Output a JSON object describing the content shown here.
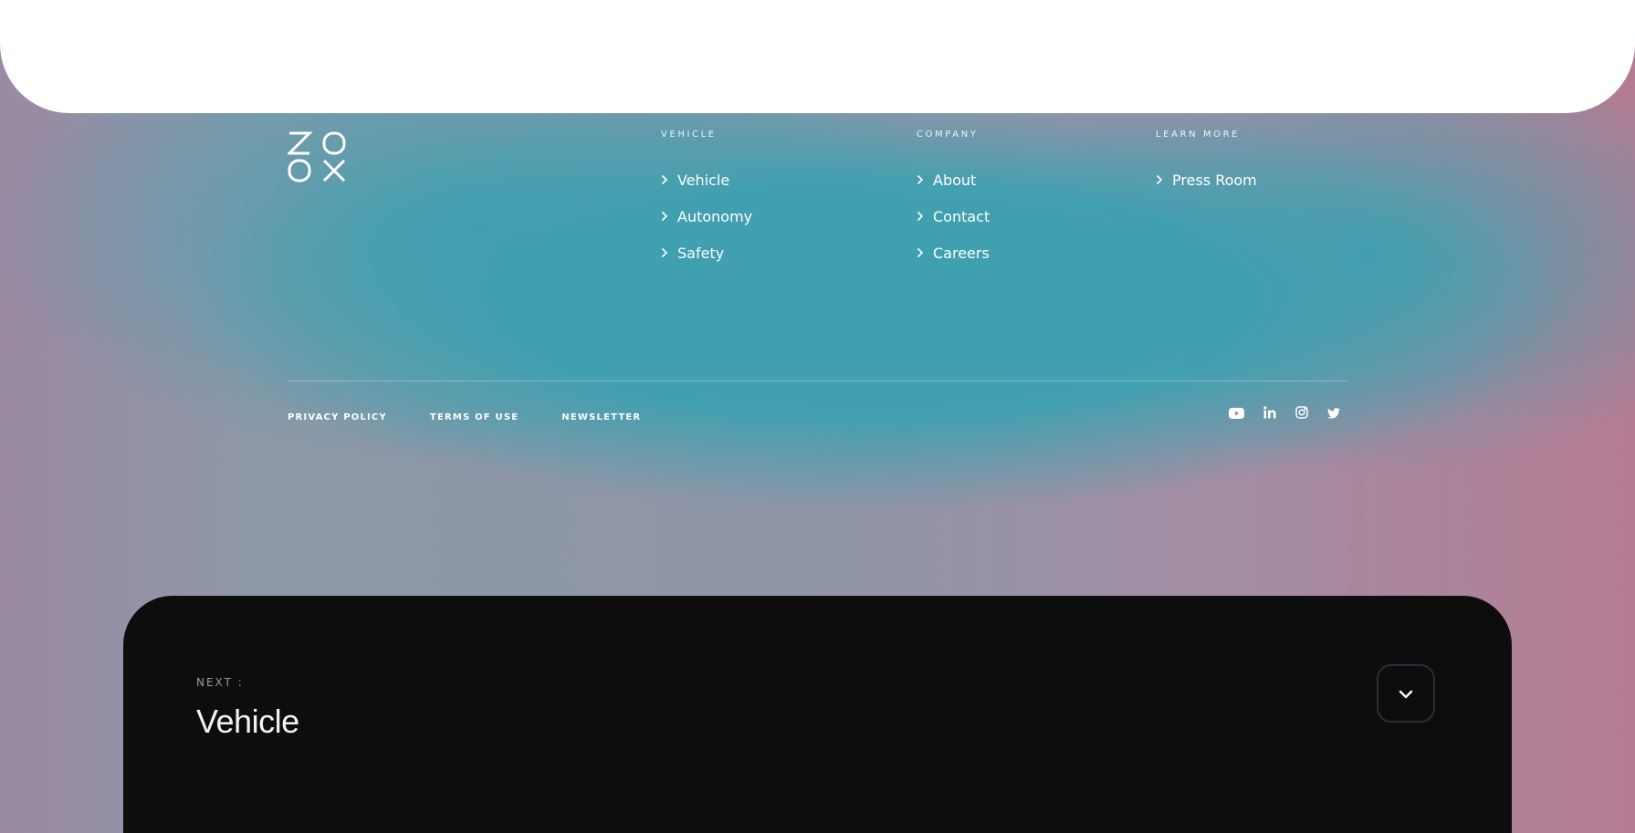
{
  "brand": {
    "logo_text": "ZOOX"
  },
  "footer": {
    "columns": [
      {
        "heading": "VEHICLE",
        "links": [
          "Vehicle",
          "Autonomy",
          "Safety"
        ]
      },
      {
        "heading": "COMPANY",
        "links": [
          "About",
          "Contact",
          "Careers"
        ]
      },
      {
        "heading": "LEARN MORE",
        "links": [
          "Press Room"
        ]
      }
    ],
    "legal_links": [
      "PRIVACY POLICY",
      "TERMS OF USE",
      "NEWSLETTER"
    ],
    "social_icons": [
      "youtube-icon",
      "linkedin-icon",
      "instagram-icon",
      "twitter-icon"
    ]
  },
  "next": {
    "label": "NEXT :",
    "title": "Vehicle",
    "button_icon": "chevron-down-icon"
  },
  "colors": {
    "teal": "#40a0b0",
    "pink": "#b47c92",
    "card_dark": "#0d0d0d",
    "top_card": "#ffffff"
  }
}
